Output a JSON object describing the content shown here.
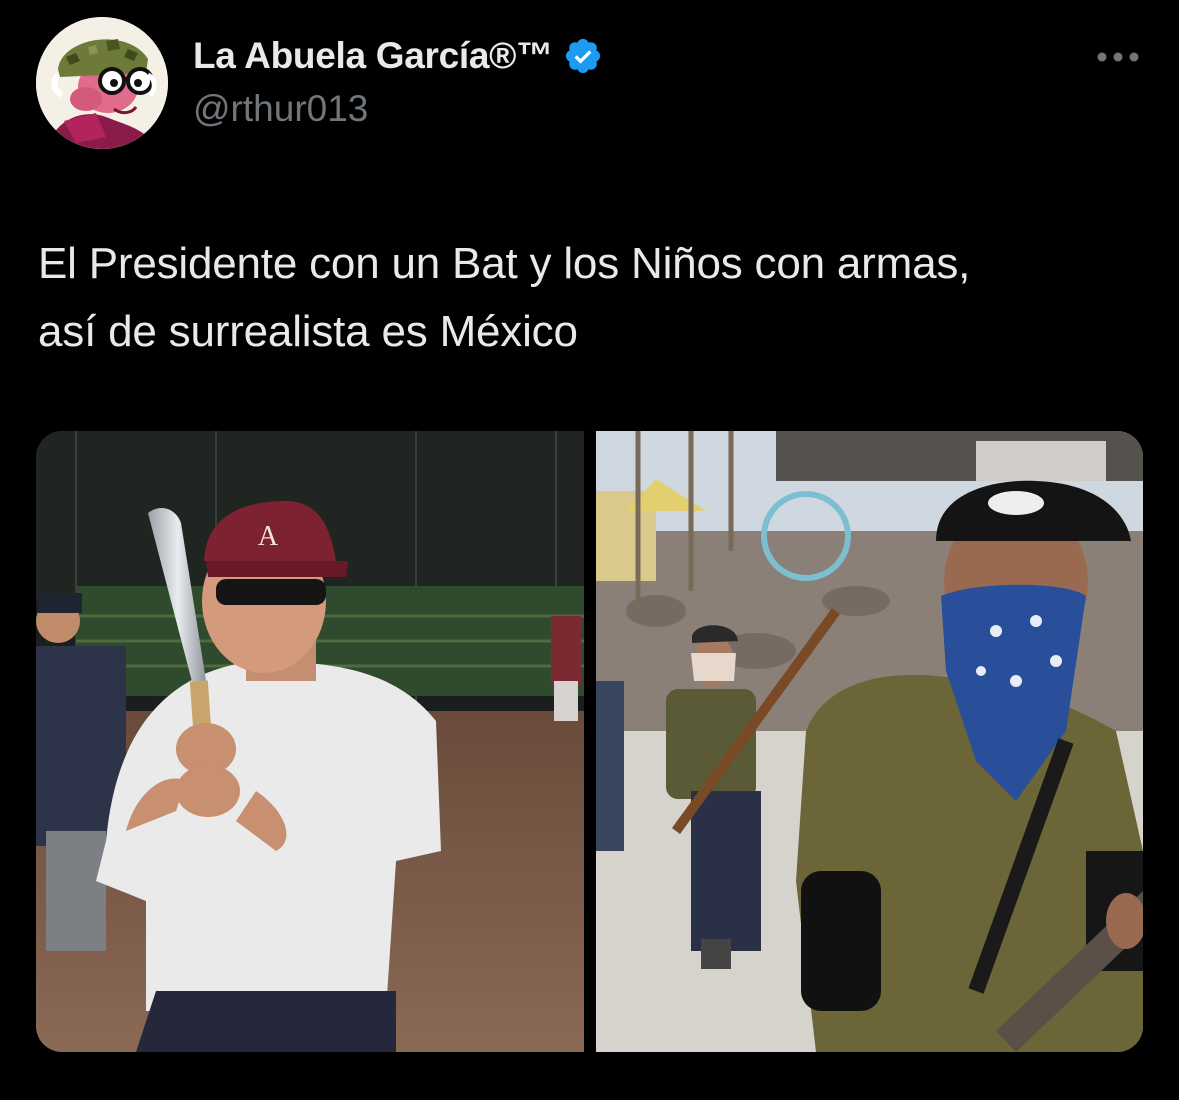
{
  "tweet": {
    "display_name": "La Abuela García®™",
    "handle": "@rthur013",
    "verified": true,
    "text": "El Presidente con un Bat y los Niños con armas,\nasí de surrealista es México",
    "more_icon": "more-horizontal-icon",
    "verified_icon": "verified-badge-icon",
    "avatar_icon": "cartoon-avatar"
  },
  "media": [
    {
      "kind": "photo",
      "subject": "man-with-baseball-bat"
    },
    {
      "kind": "photo",
      "subject": "armed-children"
    }
  ],
  "colors": {
    "background": "#000000",
    "text_primary": "#e7e9ea",
    "text_secondary": "#71767b",
    "verified_blue": "#1d9bf0"
  }
}
